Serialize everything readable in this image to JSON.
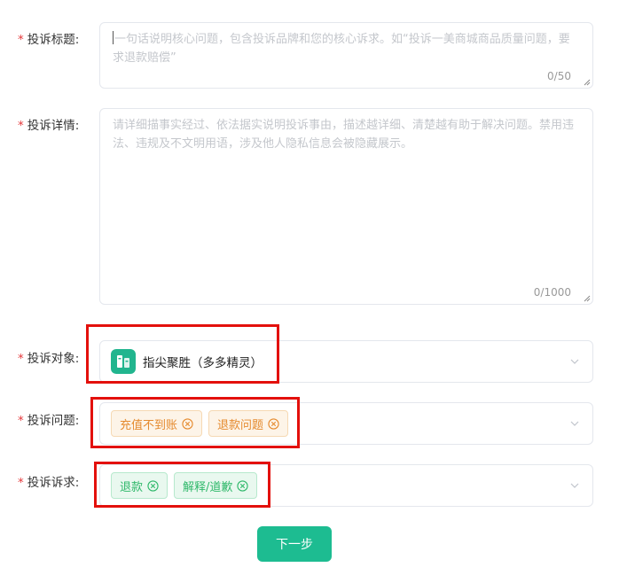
{
  "form": {
    "title": {
      "required_mark": "*",
      "label": "投诉标题:",
      "placeholder": "一句话说明核心问题，包含投诉品牌和您的核心诉求。如“投诉一美商城商品质量问题，要求退款赔偿”",
      "counter": "0/50"
    },
    "details": {
      "required_mark": "*",
      "label": "投诉详情:",
      "placeholder": "请详细描事实经过、依法据实说明投诉事由，描述越详细、清楚越有助于解决问题。禁用违法、违规及不文明用语，涉及他人隐私信息会被隐藏展示。",
      "counter": "0/1000"
    },
    "target": {
      "required_mark": "*",
      "label": "投诉对象:",
      "value": "指尖聚胜（多多精灵）",
      "logo_icon": "app-logo-icon",
      "logo_color": "#21b58e"
    },
    "issues": {
      "required_mark": "*",
      "label": "投诉问题:",
      "tags": [
        "充值不到账",
        "退款问题"
      ],
      "tag_color": "#e58a2e"
    },
    "demands": {
      "required_mark": "*",
      "label": "投诉诉求:",
      "tags": [
        "退款",
        "解释/道歉"
      ],
      "tag_color": "#2fb86a"
    }
  },
  "actions": {
    "next_label": "下一步",
    "next_color": "#1dbc91"
  },
  "annotation_color": "#e3100c"
}
